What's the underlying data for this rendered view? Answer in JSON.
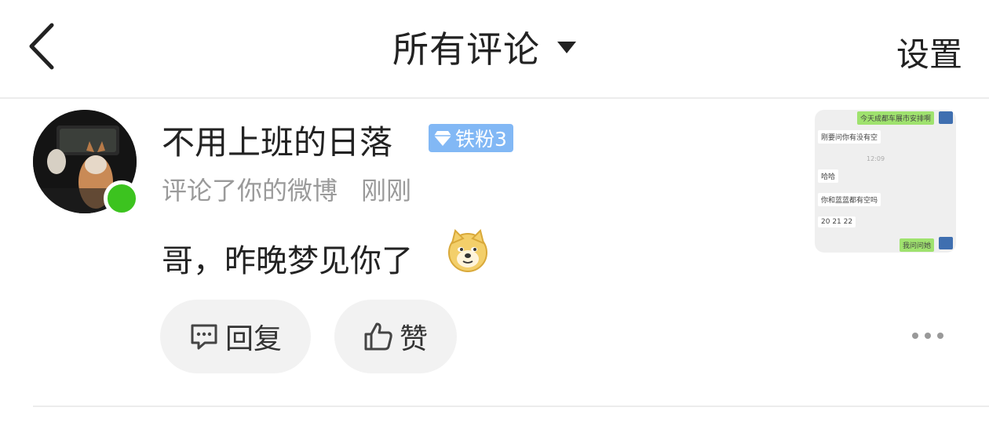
{
  "header": {
    "title": "所有评论",
    "settings_label": "设置",
    "back_icon": "chevron-left-icon",
    "dropdown_icon": "caret-down-icon"
  },
  "comment": {
    "username": "不用上班的日落",
    "badge": {
      "label": "铁粉3",
      "icon": "diamond-icon",
      "color": "#82b8f5"
    },
    "action_text": "评论了你的微博",
    "time": "刚刚",
    "text": "哥，昨晚梦见你了",
    "emoji": "doge-emoji",
    "online_status_color": "#3cc31f",
    "reply_label": "回复",
    "like_label": "赞",
    "reply_icon": "comment-icon",
    "like_icon": "thumbs-up-icon",
    "more_icon": "more-dots-icon"
  },
  "thumbnail": {
    "messages": [
      {
        "text": "今天成都车展市安排啊",
        "side": "right"
      },
      {
        "text": "刚要问你有没有空",
        "side": "left"
      },
      {
        "text": "12:09",
        "side": "time"
      },
      {
        "text": "哈哈",
        "side": "left"
      },
      {
        "text": "你和蓝蓝都有空吗",
        "side": "left"
      },
      {
        "text": "20 21 22",
        "side": "left"
      },
      {
        "text": "我问问她",
        "side": "right"
      }
    ]
  }
}
